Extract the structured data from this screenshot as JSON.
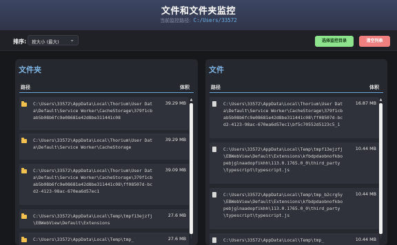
{
  "header": {
    "title": "文件和文件夹监控",
    "path_label": "当前监控路径:",
    "path_value": "C:/Users/33572"
  },
  "toolbar": {
    "sort_label": "排序:",
    "sort_value": "按大小 (最大)",
    "select_dir_button": "选择监控目录",
    "clear_button": "清空列表"
  },
  "folders": {
    "title": "文件夹",
    "col_path": "路径",
    "col_size": "体积",
    "items": [
      {
        "path": "C:\\Users\\33572\\AppData\\Local\\Thorium\\User Data\\Default\\Service Worker\\CacheStorage\\379f1cbab5b08b6fc9e08681e42d8be311441c08",
        "size": "39.29 MB"
      },
      {
        "path": "C:\\Users\\33572\\AppData\\Local\\Thorium\\User Data\\Default\\Service Worker\\CacheStorage",
        "size": "39.29 MB"
      },
      {
        "path": "C:\\Users\\33572\\AppData\\Local\\Thorium\\User Data\\Default\\Service Worker\\CacheStorage\\379f1cbab5b08b6fc9e08681e42d8be311441c08\\ff08507d-bcd2-4123-98ac-670ea6d57ec1",
        "size": "39.09 MB"
      },
      {
        "path": "C:\\Users\\33572\\AppData\\Local\\Temp\\tmpf13ejzfj\\EBWebView\\Default\\Extensions",
        "size": "27.6 MB"
      },
      {
        "path": "C:\\Users\\33572\\AppData\\Local\\Temp\\tmp_",
        "size": "27.6 MB"
      }
    ]
  },
  "files": {
    "title": "文件",
    "col_path": "路径",
    "col_size": "体积",
    "items": [
      {
        "path": "C:\\Users\\33572\\AppData\\Local\\Thorium\\User Data\\Default\\Service Worker\\CacheStorage\\379f1cbab5b08b6fc9e08681e42d8be311441c08\\ff08507d-bcd2-4123-98ac-670ea6d57ec1\\bf5c70552d5123c5_1",
        "size": "16.87 MB"
      },
      {
        "path": "C:\\Users\\33572\\AppData\\Local\\Temp\\tmpf13ejzfj\\EBWebView\\Default\\Extensions\\kfbdpdaobnofkbopebjglnaadopfikhh\\113.0.1765.0_0\\third_party\\typescript\\typescript.js",
        "size": "10.44 MB"
      },
      {
        "path": "C:\\Users\\33572\\AppData\\Local\\Temp\\tmp_b2crg5y\\EBWebView\\Default\\Extensions\\kfbdpdaobnofkbopebjglnaadopfikhh\\113.0.1765.0_0\\third_party\\typescript\\typescript.js",
        "size": "10.44 MB"
      },
      {
        "path": "C:\\Users\\33572\\AppData\\Local\\Temp\\tmp_",
        "size": "10.44 MB"
      }
    ]
  }
}
